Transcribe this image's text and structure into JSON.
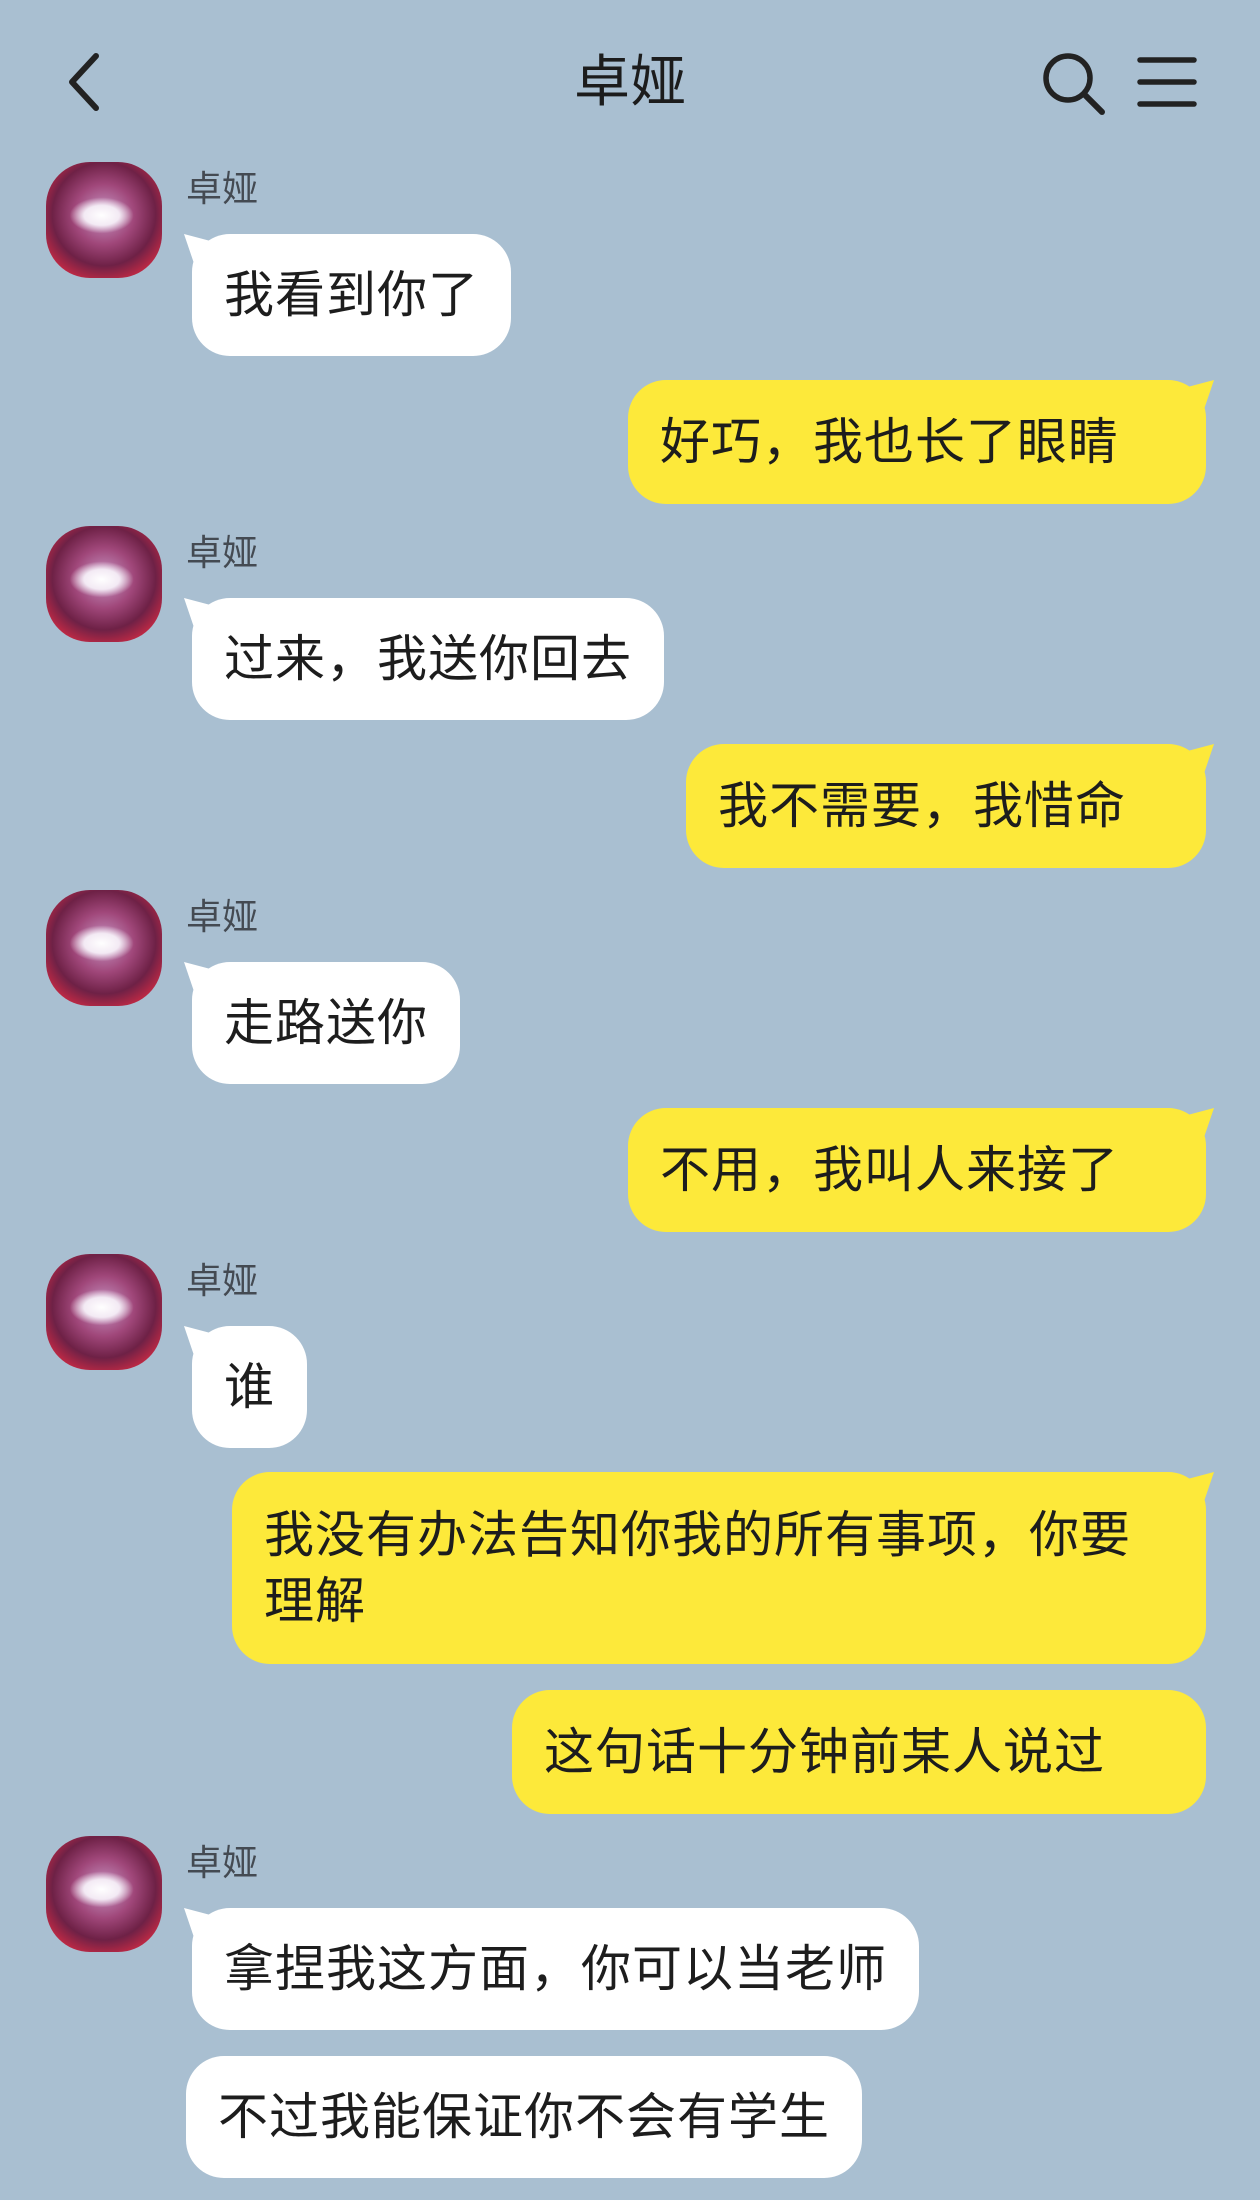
{
  "header": {
    "title": "卓娅",
    "back_icon": "chevron-left-icon",
    "search_icon": "search-icon",
    "menu_icon": "menu-icon"
  },
  "colors": {
    "background": "#a9bfd1",
    "incoming_bubble": "#ffffff",
    "outgoing_bubble": "#fde93a"
  },
  "messages": [
    {
      "direction": "in",
      "sender": "卓娅",
      "text": "我看到你了"
    },
    {
      "direction": "out",
      "text": "好巧，我也长了眼睛"
    },
    {
      "direction": "in",
      "sender": "卓娅",
      "text": "过来，我送你回去"
    },
    {
      "direction": "out",
      "text": "我不需要，我惜命"
    },
    {
      "direction": "in",
      "sender": "卓娅",
      "text": "走路送你"
    },
    {
      "direction": "out",
      "text": "不用，我叫人来接了"
    },
    {
      "direction": "in",
      "sender": "卓娅",
      "text": "谁"
    },
    {
      "direction": "out",
      "text": "我没有办法告知你我的所有事项，你要理解"
    },
    {
      "direction": "out",
      "text": "这句话十分钟前某人说过"
    },
    {
      "direction": "in",
      "sender": "卓娅",
      "text": "拿捏我这方面，你可以当老师"
    },
    {
      "direction": "in",
      "text": "不过我能保证你不会有学生"
    }
  ]
}
